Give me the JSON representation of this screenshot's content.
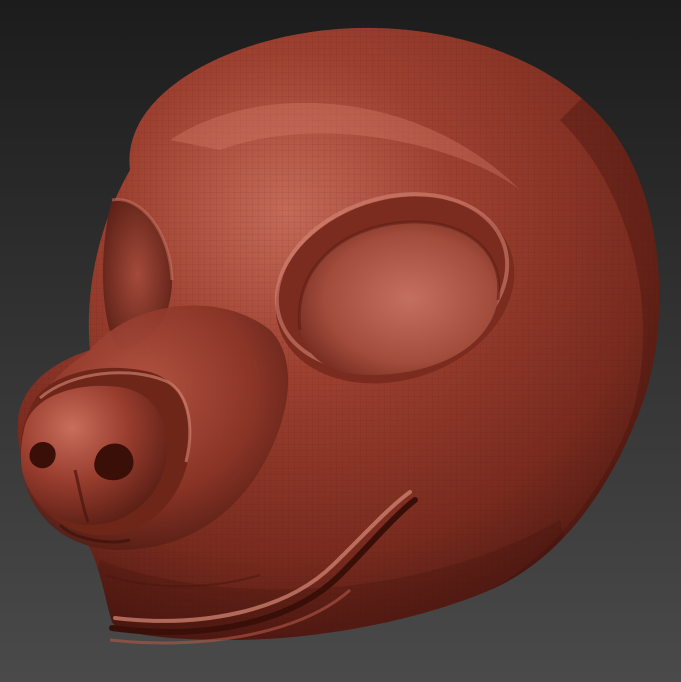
{
  "scene": {
    "subject": "",
    "colors": {
      "background_top": "#1c1c1c",
      "background_bottom": "#4a4a4a",
      "clay_base": "#8e3526",
      "clay_highlight": "#c56a58",
      "clay_shadow": "#4a1710",
      "clay_deep": "#2e0c08"
    }
  }
}
